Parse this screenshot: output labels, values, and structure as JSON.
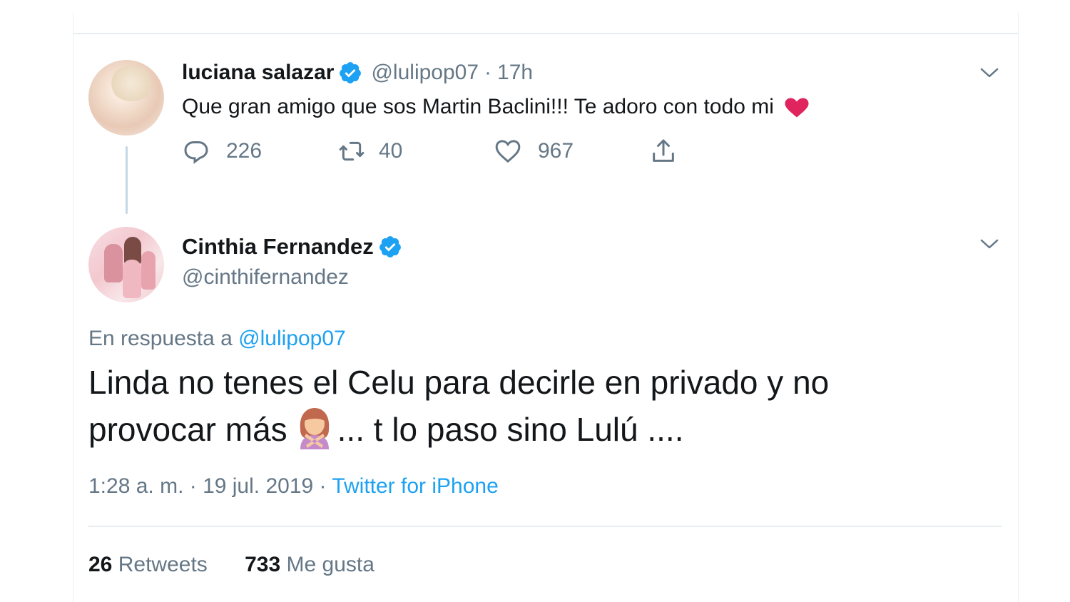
{
  "parent_tweet": {
    "name": "luciana salazar",
    "handle": "@lulipop07",
    "separator": "·",
    "time": "17h",
    "text": "Que gran amigo que sos Martin Baclini!!! Te adoro con todo mi",
    "emoji": "red-heart",
    "actions": {
      "replies": "226",
      "retweets": "40",
      "likes": "967"
    }
  },
  "focused_tweet": {
    "name": "Cinthia Fernandez",
    "handle": "@cinthifernandez",
    "reply_prefix": "En respuesta a",
    "reply_handle": "@lulipop07",
    "text_line1": "Linda no tenes el Celu para decirle en privado y no",
    "text_line2_a": "provocar más",
    "emoji": "person-gesturing-no",
    "text_line2_b": "... t lo paso sino Lulú ....",
    "timestamp": "1:28 a. m. · 19 jul. 2019 ·",
    "source": "Twitter for iPhone",
    "stats": {
      "retweets_count": "26",
      "retweets_label": "Retweets",
      "likes_count": "733",
      "likes_label": "Me gusta"
    }
  },
  "colors": {
    "primary_text": "#14171a",
    "secondary_text": "#657786",
    "accent": "#1da1f2",
    "verified": "#1da1f2",
    "divider": "#e6ecf0"
  },
  "icons": [
    "verified-badge-icon",
    "chevron-down-icon",
    "reply-icon",
    "retweet-icon",
    "like-icon",
    "share-icon"
  ]
}
